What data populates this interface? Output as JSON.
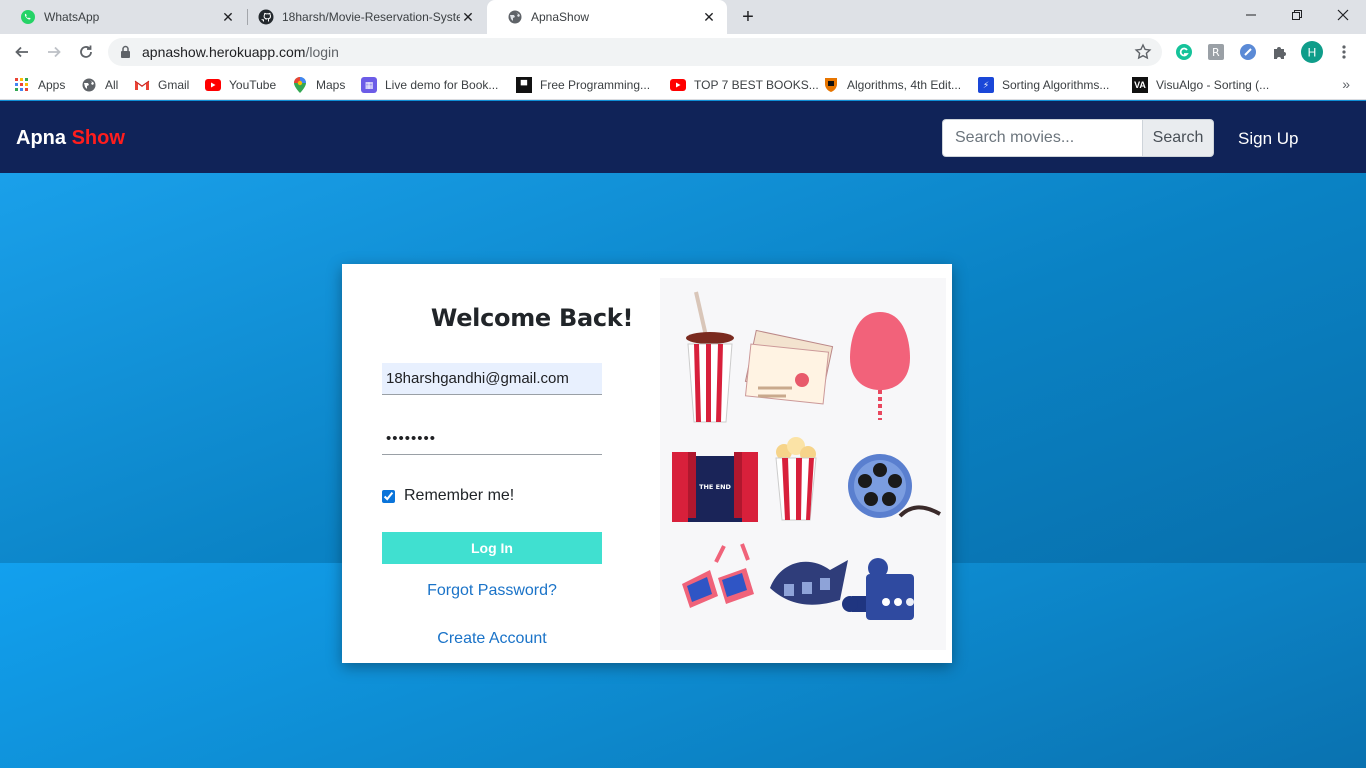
{
  "browser": {
    "tabs": [
      {
        "title": "WhatsApp",
        "active": false
      },
      {
        "title": "18harsh/Movie-Reservation-System",
        "active": false
      },
      {
        "title": "ApnaShow",
        "active": true
      }
    ],
    "url_host": "apnashow.herokuapp.com",
    "url_path": "/login",
    "profile_initial": "H",
    "bookmarks": [
      {
        "label": "Apps"
      },
      {
        "label": "All"
      },
      {
        "label": "Gmail"
      },
      {
        "label": "YouTube"
      },
      {
        "label": "Maps"
      },
      {
        "label": "Live demo for Book..."
      },
      {
        "label": "Free Programming..."
      },
      {
        "label": "TOP 7 BEST BOOKS..."
      },
      {
        "label": "Algorithms, 4th Edit..."
      },
      {
        "label": "Sorting Algorithms..."
      },
      {
        "label": "VisuAlgo - Sorting (..."
      }
    ],
    "more_bookmarks": "»"
  },
  "site": {
    "brand_primary": "Apna",
    "brand_accent": "Show",
    "search_placeholder": "Search movies...",
    "search_button": "Search",
    "signup_link": "Sign Up",
    "colors": {
      "navbar": "#102358",
      "brand_accent": "#ff1d1d",
      "login_button": "#40e0d0",
      "link": "#1a73c8"
    }
  },
  "login": {
    "heading": "Welcome Back!",
    "email_value": "18harshgandhi@gmail.com",
    "password_value": "••••••••",
    "remember_label": "Remember me!",
    "remember_checked": true,
    "login_button": "Log In",
    "forgot_link": "Forgot Password?",
    "create_link": "Create Account",
    "end_sign_text": "THE END"
  }
}
